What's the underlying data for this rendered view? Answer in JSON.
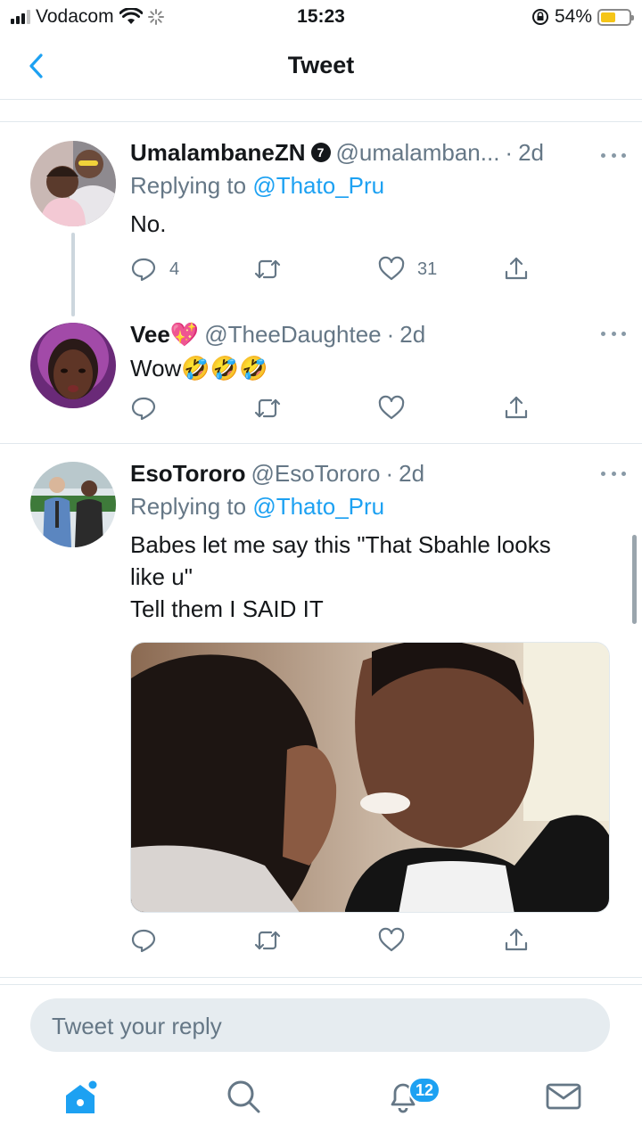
{
  "status_bar": {
    "carrier": "Vodacom",
    "time": "15:23",
    "battery_percent": "54%",
    "battery_level": 0.54
  },
  "header": {
    "title": "Tweet"
  },
  "tweets": [
    {
      "name": "UmalambaneZN",
      "verified_badge": "7",
      "handle": "@umalamban...",
      "dot": "·",
      "time": "2d",
      "replying_prefix": "Replying to",
      "replying_to": "@Thato_Pru",
      "text": "No.",
      "reply_count": "4",
      "like_count": "31"
    },
    {
      "name": "Vee💖",
      "handle": "@TheeDaughtee",
      "dot": "·",
      "time": "2d",
      "text": "Wow🤣🤣🤣"
    },
    {
      "name": "EsoTororo",
      "handle": "@EsoTororo",
      "dot": "·",
      "time": "2d",
      "replying_prefix": "Replying to",
      "replying_to": "@Thato_Pru",
      "text_line1": "Babes let me say this \"That Sbahle looks",
      "text_line2": "like u\"",
      "text_line3": "Tell them I SAID IT"
    }
  ],
  "reply_box": {
    "placeholder": "Tweet your reply"
  },
  "tabbar": {
    "notifications_badge": "12"
  },
  "colors": {
    "accent": "#1da1f2",
    "secondary_text": "#657786",
    "divider": "#e1e8ed"
  },
  "icons": [
    "back-chevron-icon",
    "reply-icon",
    "retweet-icon",
    "like-icon",
    "share-icon",
    "home-icon",
    "search-icon",
    "notifications-icon",
    "messages-icon"
  ]
}
